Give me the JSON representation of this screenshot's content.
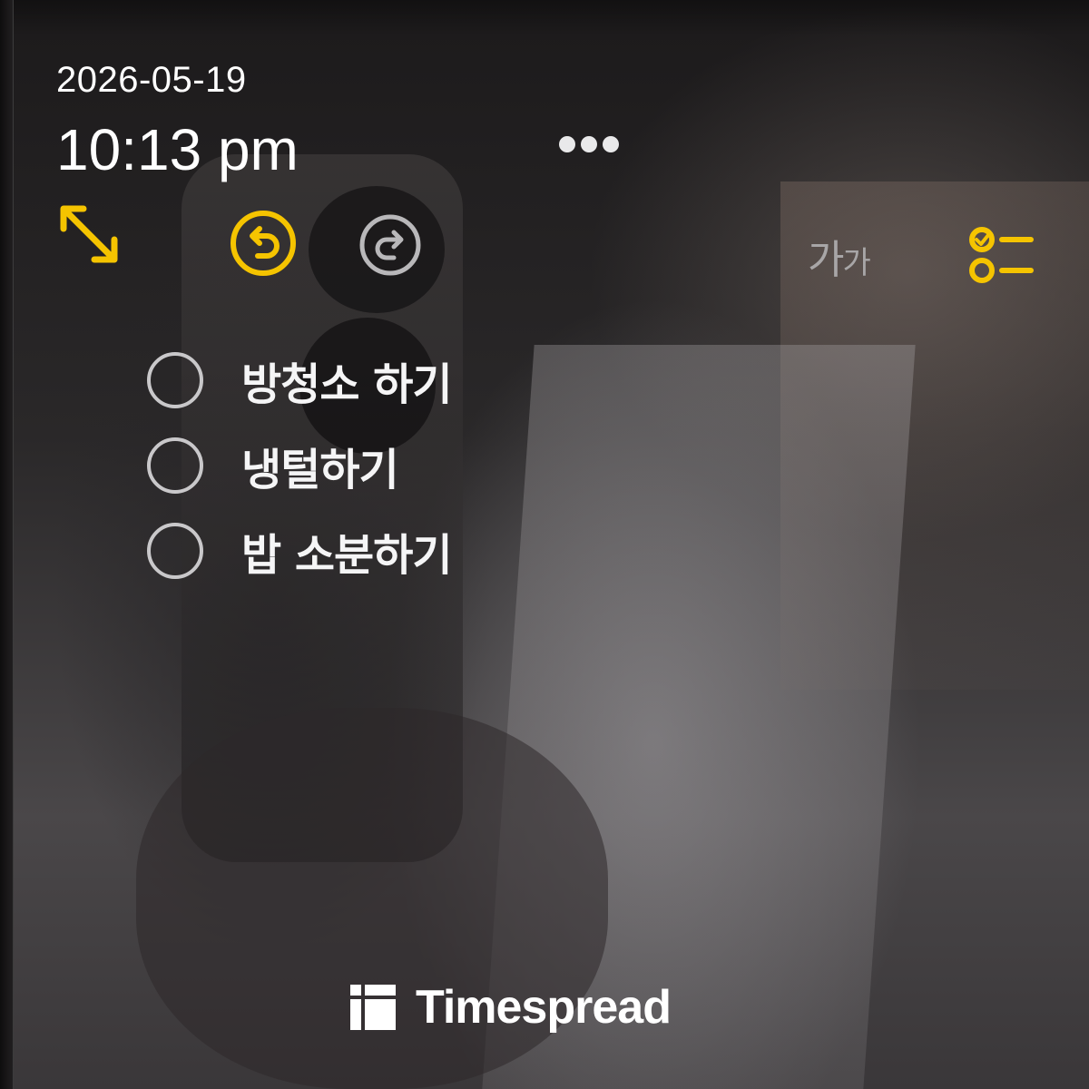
{
  "timestamp": {
    "date": "2026-05-19",
    "time": "10:13 pm"
  },
  "toolbar": {
    "more_icon": "more-dots-icon",
    "expand_icon": "expand-arrows-icon",
    "undo_icon": "undo-icon",
    "redo_icon": "redo-icon",
    "font_size_label_large": "가",
    "font_size_label_small": "가",
    "checklist_icon": "checklist-icon",
    "accent_color": "#f5c400",
    "inactive_color": "#b9b8ba"
  },
  "todos": [
    {
      "label": "방청소 하기",
      "checked": false
    },
    {
      "label": "냉털하기",
      "checked": false
    },
    {
      "label": "밥 소분하기",
      "checked": false
    }
  ],
  "watermark": {
    "brand": "Timespread",
    "logo_icon": "timespread-logo-icon"
  }
}
